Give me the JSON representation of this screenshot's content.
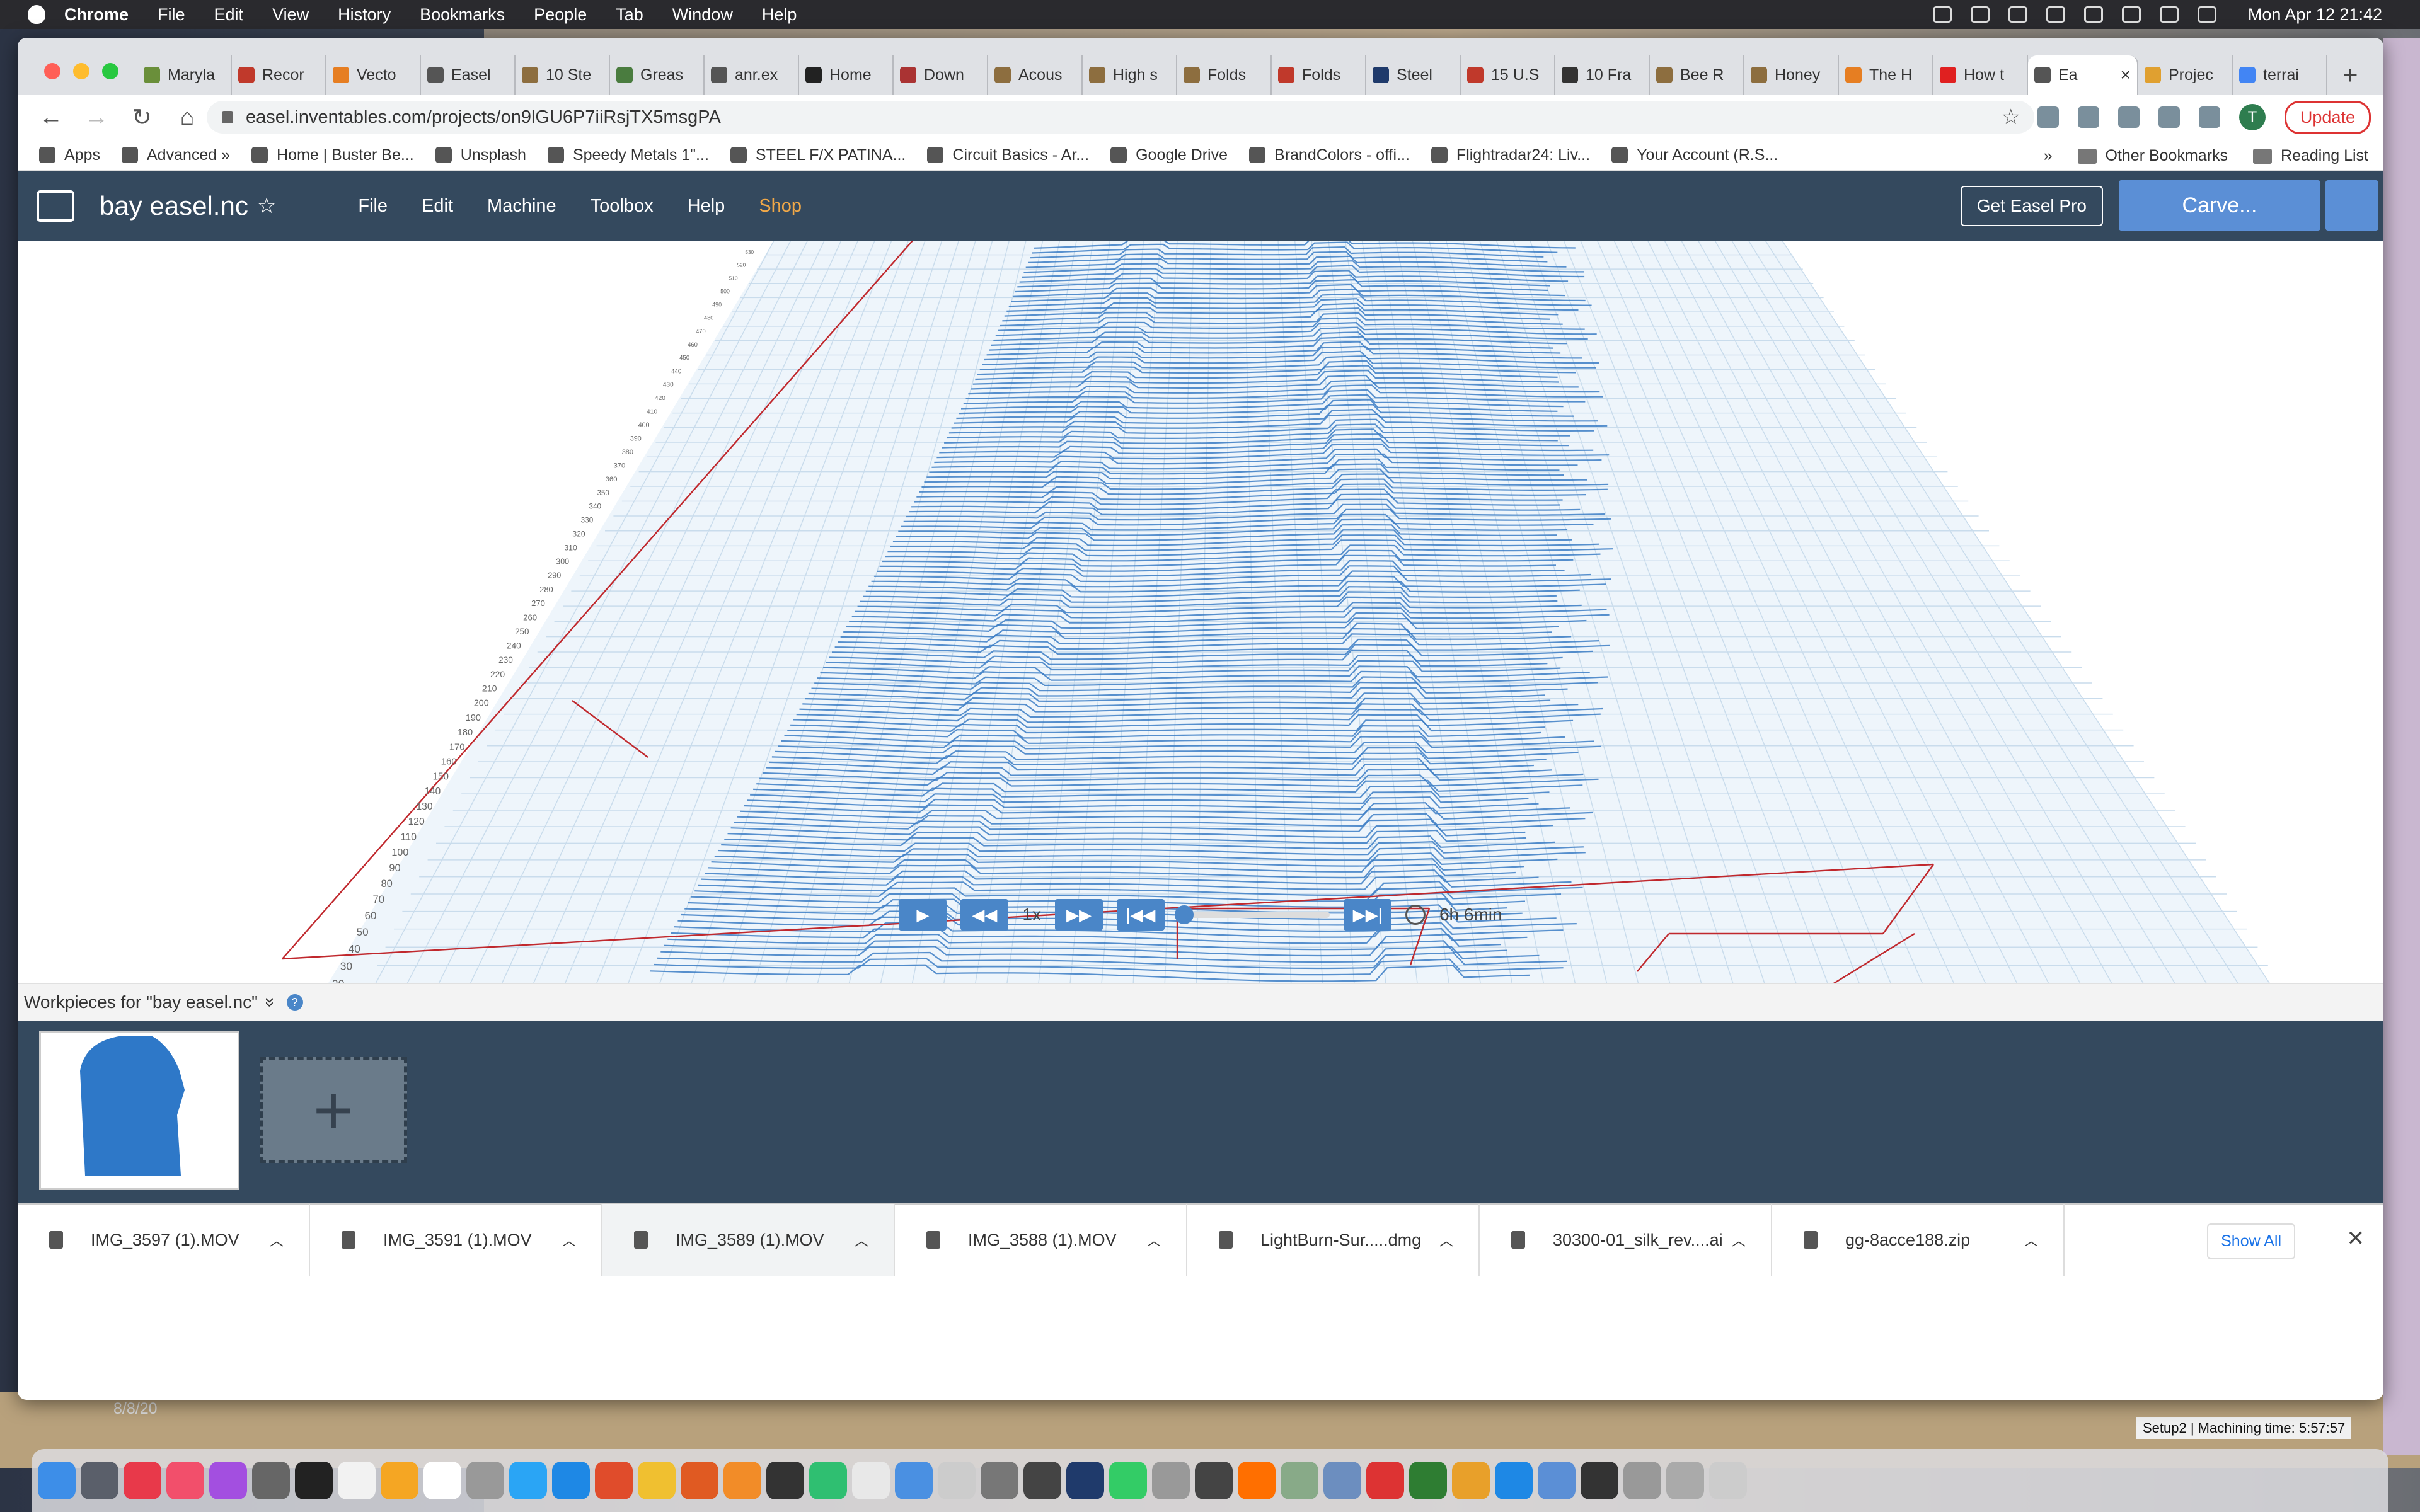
{
  "menubar": {
    "app": "Chrome",
    "items": [
      "File",
      "Edit",
      "View",
      "History",
      "Bookmarks",
      "People",
      "Tab",
      "Window",
      "Help"
    ],
    "clock": "Mon Apr 12  21:42"
  },
  "tabs": [
    {
      "label": "Maryla",
      "color": "#6a8f3a"
    },
    {
      "label": "Recor",
      "color": "#c0392b"
    },
    {
      "label": "Vecto",
      "color": "#e67e22"
    },
    {
      "label": "Easel",
      "color": "#555555"
    },
    {
      "label": "10 Ste",
      "color": "#8d6e3f"
    },
    {
      "label": "Greas",
      "color": "#4a7c3f"
    },
    {
      "label": "anr.ex",
      "color": "#555555"
    },
    {
      "label": "Home",
      "color": "#222222"
    },
    {
      "label": "Down",
      "color": "#a33"
    },
    {
      "label": "Acous",
      "color": "#8d6e3f"
    },
    {
      "label": "High s",
      "color": "#8d6e3f"
    },
    {
      "label": "Folds",
      "color": "#8d6e3f"
    },
    {
      "label": "Folds",
      "color": "#c0392b"
    },
    {
      "label": "Steel",
      "color": "#1f3a6b"
    },
    {
      "label": "15 U.S",
      "color": "#c0392b"
    },
    {
      "label": "10 Fra",
      "color": "#333333"
    },
    {
      "label": "Bee R",
      "color": "#8d6e3f"
    },
    {
      "label": "Honey",
      "color": "#8d6e3f"
    },
    {
      "label": "The H",
      "color": "#e67e22"
    },
    {
      "label": "How t",
      "color": "#e02020"
    },
    {
      "label": "Ea",
      "color": "#555555",
      "active": true
    },
    {
      "label": "Projec",
      "color": "#e0a030"
    },
    {
      "label": "terrai",
      "color": "#4285f4"
    }
  ],
  "toolbar": {
    "url": "easel.inventables.com/projects/on9lGU6P7iiRsjTX5msgPA",
    "avatar": "T",
    "update_label": "Update"
  },
  "bookmarks": {
    "items": [
      "Apps",
      "Advanced »",
      "Home | Buster Be...",
      "Unsplash",
      "Speedy Metals 1\"...",
      "STEEL F/X PATINA...",
      "Circuit Basics - Ar...",
      "Google Drive",
      "BrandColors - offi...",
      "Flightradar24: Liv...",
      "Your Account (R.S..."
    ],
    "more": "»",
    "other": "Other Bookmarks",
    "reading": "Reading List"
  },
  "easel": {
    "project_name": "bay easel.nc",
    "menu": [
      "File",
      "Edit",
      "Machine",
      "Toolbox",
      "Help",
      "Shop"
    ],
    "get_pro": "Get Easel Pro",
    "carve": "Carve..."
  },
  "preview": {
    "x_ticks": [
      "0",
      "10",
      "20",
      "30",
      "40",
      "50",
      "60",
      "70",
      "80",
      "90",
      "100",
      "110",
      "120",
      "130",
      "140",
      "150",
      "160",
      "170",
      "180",
      "190",
      "200",
      "210",
      "220",
      "230",
      "240",
      "250",
      "260",
      "270",
      "280",
      "290",
      "300",
      "310",
      "320",
      "330",
      "340",
      "350",
      "360",
      "370",
      "380",
      "390",
      "400",
      "410",
      "420",
      "430",
      "440",
      "450",
      "460",
      "470",
      "480",
      "490",
      "500",
      "510",
      "520",
      "530",
      "540",
      "550",
      "560",
      "570",
      "580",
      "590",
      "600",
      "610",
      "620",
      "630",
      "640",
      "650",
      "660",
      "670",
      "680",
      "690",
      "700",
      "710",
      "720",
      "730",
      "740",
      "750"
    ],
    "y_ticks": [
      "0",
      "10",
      "20",
      "30",
      "40",
      "50",
      "60",
      "70",
      "80",
      "90",
      "100",
      "110",
      "120",
      "130",
      "140",
      "150",
      "160",
      "170",
      "180",
      "190",
      "200",
      "210",
      "220",
      "230",
      "240",
      "250",
      "260",
      "270",
      "280",
      "290",
      "300",
      "310",
      "320",
      "330",
      "340",
      "350",
      "360",
      "370",
      "380",
      "390",
      "400",
      "410",
      "420",
      "430",
      "440",
      "450",
      "460",
      "470",
      "480",
      "490",
      "500",
      "510",
      "520",
      "530",
      "540"
    ],
    "toolpath_color": "#3b7dc4",
    "travel_color": "#c0282d"
  },
  "player": {
    "speed": "1x",
    "progress": 0,
    "duration": "6h 6min"
  },
  "workpieces": {
    "header": "Workpieces for \"bay easel.nc\"",
    "chevron": "»",
    "help": "?",
    "add_symbol": "+",
    "thumb_color": "#2e78c8"
  },
  "downloads": {
    "files": [
      "IMG_3597 (1).MOV",
      "IMG_3591 (1).MOV",
      "IMG_3589 (1).MOV",
      "IMG_3588 (1).MOV",
      "LightBurn-Sur.....dmg",
      "30300-01_silk_rev....ai",
      "gg-8acce188.zip"
    ],
    "show_all": "Show All",
    "close": "✕"
  },
  "desktop": {
    "date": "8/8/20",
    "machining_text": "Setup2 | Machining time: 5:57:57"
  }
}
